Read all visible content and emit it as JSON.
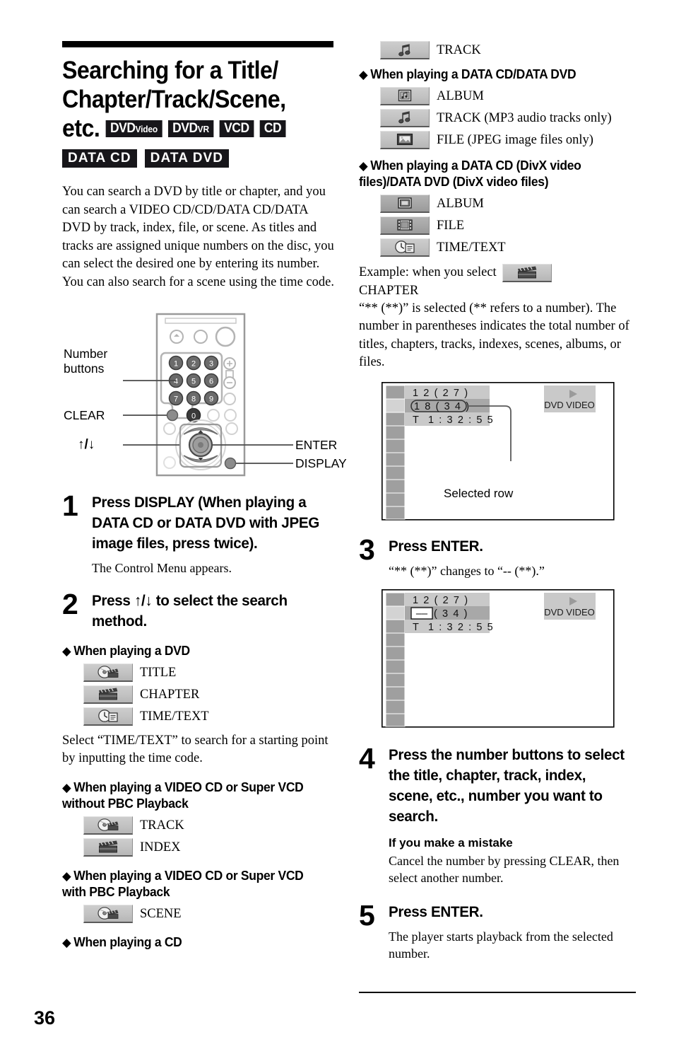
{
  "page": {
    "number": "36"
  },
  "heading": {
    "line1": "Searching for a Title/",
    "line2": "Chapter/Track/Scene,",
    "line3": "etc.",
    "badges_row1": [
      {
        "name": "dvd-video",
        "big": "DVD",
        "small": "Video"
      },
      {
        "name": "dvd-vr",
        "big": "DVD",
        "small": "VR"
      },
      {
        "name": "vcd",
        "big": "VCD",
        "small": ""
      },
      {
        "name": "cd",
        "big": "CD",
        "small": ""
      }
    ],
    "badges_row2": [
      {
        "name": "data-cd",
        "text": "DATA CD"
      },
      {
        "name": "data-dvd",
        "text": "DATA DVD"
      }
    ]
  },
  "intro": "You can search a DVD by title or chapter, and you can search a VIDEO CD/CD/DATA CD/DATA DVD by track, index, file, or scene. As titles and tracks are assigned unique numbers on the disc, you can select the desired one by entering its number. You can also search for a scene using the time code.",
  "remote": {
    "label_number_buttons_l1": "Number",
    "label_number_buttons_l2": "buttons",
    "label_clear": "CLEAR",
    "label_updown": "↑/↓",
    "label_enter": "ENTER",
    "label_display": "DISPLAY",
    "keys": [
      "1",
      "2",
      "3",
      "4",
      "5",
      "6",
      "7",
      "8",
      "9",
      "0"
    ]
  },
  "steps": {
    "one": {
      "num": "1",
      "head": "Press DISPLAY (When playing a DATA CD or DATA DVD with JPEG image files, press twice).",
      "sub": "The Control Menu appears."
    },
    "two": {
      "num": "2",
      "head": "Press ↑/↓ to select the search method."
    },
    "three": {
      "num": "3",
      "head": "Press ENTER.",
      "sub": "“** (**)” changes to “-- (**).”"
    },
    "four": {
      "num": "4",
      "head": "Press the number buttons to select the title, chapter, track, index, scene, etc., number you want to search.",
      "sub_title": "If you make a mistake",
      "sub": "Cancel the number by pressing CLEAR, then select another number."
    },
    "five": {
      "num": "5",
      "head": "Press ENTER.",
      "sub": "The player starts playback from the selected number."
    }
  },
  "sections": {
    "dvd": {
      "heading": "When playing a DVD",
      "items": [
        {
          "icon": "title-icon",
          "label": "TITLE"
        },
        {
          "icon": "chapter-icon",
          "label": "CHAPTER"
        },
        {
          "icon": "time-text-icon",
          "label": "TIME/TEXT"
        }
      ],
      "note": "Select “TIME/TEXT” to search for a starting point by inputting the time code."
    },
    "vcd_without_pbc": {
      "heading_l1": "When playing a VIDEO CD or Super VCD",
      "heading_l2": "without PBC Playback",
      "items": [
        {
          "icon": "track-icon",
          "label": "TRACK"
        },
        {
          "icon": "index-icon",
          "label": "INDEX"
        }
      ]
    },
    "vcd_with_pbc": {
      "heading_l1": "When playing a VIDEO CD or Super VCD",
      "heading_l2": "with PBC Playback",
      "items": [
        {
          "icon": "scene-icon",
          "label": "SCENE"
        }
      ]
    },
    "cd": {
      "heading": "When playing a CD",
      "items": [
        {
          "icon": "music-note-icon",
          "label": "TRACK"
        }
      ]
    },
    "data_cd_dvd": {
      "heading": "When playing a DATA CD/DATA DVD",
      "items": [
        {
          "icon": "album-icon",
          "label": "ALBUM"
        },
        {
          "icon": "music-note-icon",
          "label": "TRACK (MP3 audio tracks only)"
        },
        {
          "icon": "picture-file-icon",
          "label": "FILE (JPEG image files only)"
        }
      ]
    },
    "divx": {
      "heading_l1": "When playing a DATA CD (DivX video",
      "heading_l2": "files)/DATA DVD (DivX video files)",
      "items": [
        {
          "icon": "album-divx-icon",
          "label": "ALBUM"
        },
        {
          "icon": "film-file-icon",
          "label": "FILE"
        },
        {
          "icon": "time-text-icon",
          "label": "TIME/TEXT"
        }
      ]
    }
  },
  "example": {
    "lead": "Example: when you select",
    "icon": "chapter-icon",
    "second_line": "CHAPTER",
    "explain": "“** (**)” is selected (** refers to a number). The number in parentheses indicates the total number of titles, chapters, tracks, indexes, scenes, albums, or files."
  },
  "osd_first": {
    "row1": "1 2 ( 2 7 )",
    "row2": "1 8 ( 3 4 )",
    "row3_label": "T",
    "row3_time": "1 : 3 2 : 5 5",
    "disc_label": "DVD VIDEO",
    "caption": "Selected row"
  },
  "osd_second": {
    "row1": "1 2 ( 2 7 )",
    "row2_dashes": "––",
    "row2_total": "( 3 4 )",
    "row3_label": "T",
    "row3_time": "1 : 3 2 : 5 5",
    "disc_label": "DVD VIDEO"
  }
}
